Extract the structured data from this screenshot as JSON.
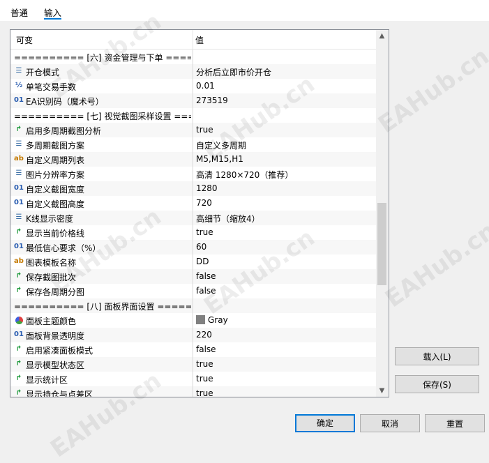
{
  "tabs": [
    {
      "label": "普通"
    },
    {
      "label": "输入"
    }
  ],
  "grid": {
    "header": {
      "col1": "可变",
      "col2": "值"
    },
    "rows": [
      {
        "type": "section",
        "name": "========== [六] 资金管理与下单 ======="
      },
      {
        "type": "param",
        "icon": "list-icon",
        "glyph": "☰",
        "name": "开仓模式",
        "value": "分析后立即市价开仓"
      },
      {
        "type": "param",
        "icon": "fraction-icon",
        "glyph": "½",
        "name": "单笔交易手数",
        "value": "0.01"
      },
      {
        "type": "param",
        "icon": "integer-icon",
        "glyph": "01",
        "name": "EA识别码（魔术号）",
        "value": "273519"
      },
      {
        "type": "section",
        "name": "========== [七] 视觉截图采样设置 ====="
      },
      {
        "type": "param",
        "icon": "bool-arrow-icon",
        "glyph": "↱",
        "name": "启用多周期截图分析",
        "value": "true"
      },
      {
        "type": "param",
        "icon": "list-icon",
        "glyph": "☰",
        "name": "多周期截图方案",
        "value": "自定义多周期"
      },
      {
        "type": "param",
        "icon": "string-icon",
        "glyph": "ab",
        "name": "自定义周期列表",
        "value": "M5,M15,H1"
      },
      {
        "type": "param",
        "icon": "list-icon",
        "glyph": "☰",
        "name": "图片分辨率方案",
        "value": "高清 1280×720（推荐）"
      },
      {
        "type": "param",
        "icon": "integer-icon",
        "glyph": "01",
        "name": "自定义截图宽度",
        "value": "1280"
      },
      {
        "type": "param",
        "icon": "integer-icon",
        "glyph": "01",
        "name": "自定义截图高度",
        "value": "720"
      },
      {
        "type": "param",
        "icon": "list-icon",
        "glyph": "☰",
        "name": "K线显示密度",
        "value": "高细节（缩放4）"
      },
      {
        "type": "param",
        "icon": "bool-arrow-icon",
        "glyph": "↱",
        "name": "显示当前价格线",
        "value": "true"
      },
      {
        "type": "param",
        "icon": "integer-icon",
        "glyph": "01",
        "name": "最低信心要求（%）",
        "value": "60"
      },
      {
        "type": "param",
        "icon": "string-icon",
        "glyph": "ab",
        "name": "图表模板名称",
        "value": "DD"
      },
      {
        "type": "param",
        "icon": "bool-arrow-icon",
        "glyph": "↱",
        "name": "保存截图批次",
        "value": "false"
      },
      {
        "type": "param",
        "icon": "bool-arrow-icon",
        "glyph": "↱",
        "name": "保存各周期分图",
        "value": "false"
      },
      {
        "type": "section",
        "name": "========== [八] 面板界面设置 ========="
      },
      {
        "type": "param",
        "icon": "color-icon",
        "glyph": "●",
        "name": "面板主题颜色",
        "value": "Gray",
        "swatch": "#808080"
      },
      {
        "type": "param",
        "icon": "integer-icon",
        "glyph": "01",
        "name": "面板背景透明度",
        "value": "220"
      },
      {
        "type": "param",
        "icon": "bool-arrow-icon",
        "glyph": "↱",
        "name": "启用紧凑面板模式",
        "value": "false"
      },
      {
        "type": "param",
        "icon": "bool-arrow-icon",
        "glyph": "↱",
        "name": "显示模型状态区",
        "value": "true"
      },
      {
        "type": "param",
        "icon": "bool-arrow-icon",
        "glyph": "↱",
        "name": "显示统计区",
        "value": "true"
      },
      {
        "type": "param",
        "icon": "bool-arrow-icon",
        "glyph": "↱",
        "name": "显示持仓与点差区",
        "value": "true"
      }
    ]
  },
  "side_buttons": {
    "load": "载入(L)",
    "save": "保存(S)"
  },
  "footer_buttons": {
    "ok": "确定",
    "cancel": "取消",
    "reset": "重置"
  },
  "watermark": "EAHub.cn",
  "colors": {
    "accent": "#0078d7",
    "bool_icon": "#1f9a3c",
    "int_icon": "#2a5db0",
    "string_icon": "#c47a00"
  }
}
